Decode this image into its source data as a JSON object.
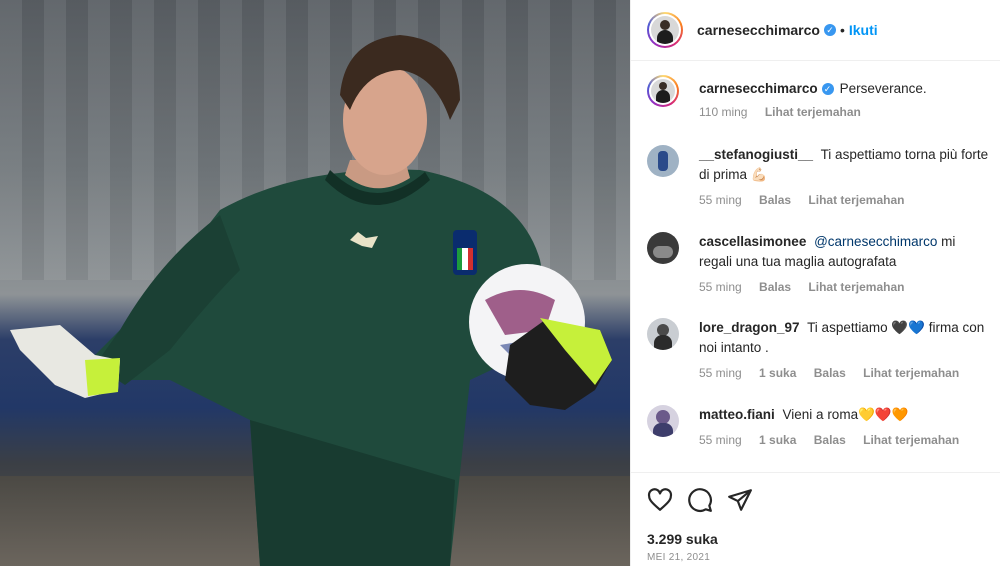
{
  "post": {
    "username": "carnesecchimarco",
    "follow_label": "Ikuti",
    "verified_icon": "verified-badge-icon",
    "caption": "Perseverance.",
    "caption_time": "110 ming",
    "caption_translate": "Lihat terjemahan"
  },
  "comments": [
    {
      "user": "__stefanogiusti__",
      "text": "Ti aspettiamo torna più forte di prima 💪🏻",
      "time": "55 ming",
      "likes": "",
      "reply": "Balas",
      "translate": "Lihat terjemahan"
    },
    {
      "user": "cascellasimonee",
      "mention": "@carnesecchimarco",
      "text": " mi regali una tua maglia autografata",
      "time": "55 ming",
      "likes": "",
      "reply": "Balas",
      "translate": "Lihat terjemahan"
    },
    {
      "user": "lore_dragon_97",
      "text": "Ti aspettiamo 🖤💙 firma con noi intanto .",
      "time": "55 ming",
      "likes": "1 suka",
      "reply": "Balas",
      "translate": "Lihat terjemahan"
    },
    {
      "user": "matteo.fiani",
      "text": "Vieni a roma💛❤️🧡",
      "time": "55 ming",
      "likes": "1 suka",
      "reply": "Balas",
      "translate": "Lihat terjemahan"
    }
  ],
  "footer": {
    "like_count": "3.299 suka",
    "date": "MEI 21, 2021",
    "icons": [
      "heart-icon",
      "comment-icon",
      "share-icon"
    ]
  },
  "colors": {
    "accent": "#0095f6",
    "verified": "#3897f0",
    "muted": "#8e8e8e",
    "jersey": "#1f4a3c",
    "glove": "#c6f03a"
  }
}
